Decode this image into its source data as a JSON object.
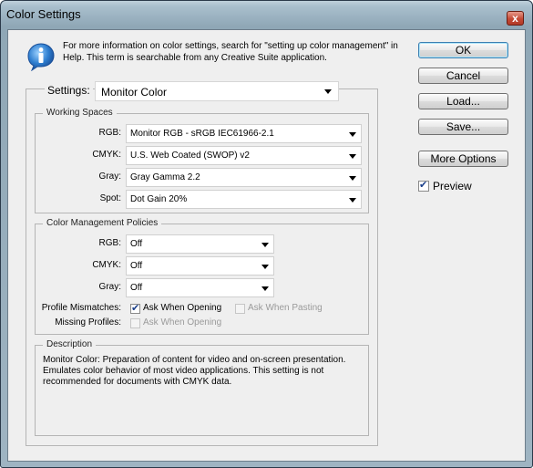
{
  "window": {
    "title": "Color Settings",
    "close_label": "x"
  },
  "info": {
    "text": "For more information on color settings, search for \"setting up color management\" in Help. This term is searchable from any Creative Suite application."
  },
  "settings": {
    "label": "Settings:",
    "value": "Monitor Color"
  },
  "working_spaces": {
    "legend": "Working Spaces",
    "rgb_label": "RGB:",
    "rgb_value": "Monitor RGB - sRGB IEC61966-2.1",
    "cmyk_label": "CMYK:",
    "cmyk_value": "U.S. Web Coated (SWOP) v2",
    "gray_label": "Gray:",
    "gray_value": "Gray Gamma 2.2",
    "spot_label": "Spot:",
    "spot_value": "Dot Gain 20%"
  },
  "policies": {
    "legend": "Color Management Policies",
    "rgb_label": "RGB:",
    "rgb_value": "Off",
    "cmyk_label": "CMYK:",
    "cmyk_value": "Off",
    "gray_label": "Gray:",
    "gray_value": "Off",
    "mismatch_label": "Profile Mismatches:",
    "ask_opening": "Ask When Opening",
    "ask_pasting": "Ask When Pasting",
    "missing_label": "Missing Profiles:",
    "missing_ask_opening": "Ask When Opening",
    "ask_opening_checked": true,
    "ask_pasting_checked": false,
    "missing_ask_opening_checked": false
  },
  "description": {
    "legend": "Description",
    "text": "Monitor Color:  Preparation of content for video and on-screen presentation. Emulates color behavior of most video applications. This setting is not recommended for documents with CMYK data."
  },
  "buttons": {
    "ok": "OK",
    "cancel": "Cancel",
    "load": "Load...",
    "save": "Save...",
    "more_options": "More Options"
  },
  "preview": {
    "label": "Preview",
    "checked": true
  },
  "colors": {
    "title_bar": "#8fa7b6",
    "dialog_bg": "#efefef",
    "close_button": "#c44a36",
    "default_button_border": "#3c7fb1",
    "check_color": "#1a3f8a"
  }
}
